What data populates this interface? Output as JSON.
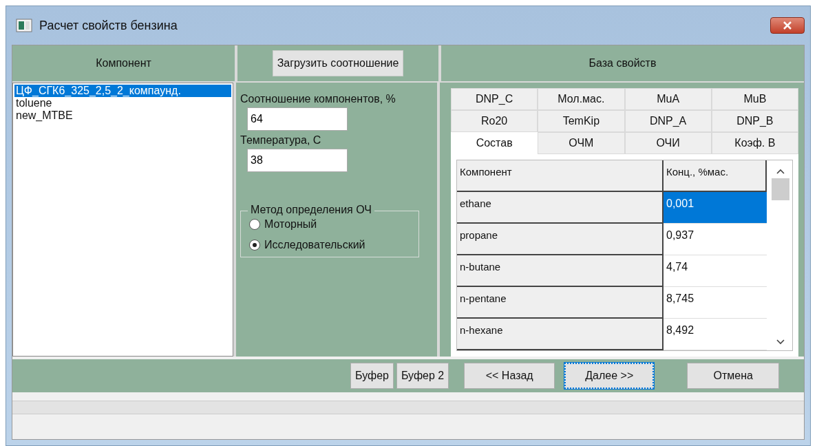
{
  "window": {
    "title": "Расчет свойств бензина"
  },
  "headers": {
    "components": "Компонент",
    "load_button": "Загрузить соотношение",
    "properties": "База свойств"
  },
  "component_list": [
    {
      "label": "ЦФ_СГК6_325_2,5_2_компаунд.",
      "selected": true
    },
    {
      "label": "toluene",
      "selected": false
    },
    {
      "label": "new_MTBE",
      "selected": false
    }
  ],
  "ratio": {
    "label": "Соотношение компонентов, %",
    "value": "64"
  },
  "temperature": {
    "label": "Температура, С",
    "value": "38"
  },
  "octane_method": {
    "title": "Метод определения ОЧ",
    "options": [
      {
        "label": "Моторный",
        "selected": false
      },
      {
        "label": "Исследовательский",
        "selected": true
      }
    ]
  },
  "tab_rows": [
    [
      {
        "label": "DNP_C",
        "selected": false
      },
      {
        "label": "Мол.мас.",
        "selected": false
      },
      {
        "label": "MuA",
        "selected": false
      },
      {
        "label": "MuB",
        "selected": false
      }
    ],
    [
      {
        "label": "Ro20",
        "selected": false
      },
      {
        "label": "TemKip",
        "selected": false
      },
      {
        "label": "DNP_A",
        "selected": false
      },
      {
        "label": "DNP_B",
        "selected": false
      }
    ],
    [
      {
        "label": "Состав",
        "selected": true
      },
      {
        "label": "ОЧМ",
        "selected": false
      },
      {
        "label": "ОЧИ",
        "selected": false
      },
      {
        "label": "Коэф. В",
        "selected": false
      }
    ]
  ],
  "table": {
    "columns": [
      "Компонент",
      "Конц., %мас."
    ],
    "rows": [
      {
        "name": "ethane",
        "value": "0,001",
        "selected": true
      },
      {
        "name": "propane",
        "value": "0,937",
        "selected": false
      },
      {
        "name": "n-butane",
        "value": "4,74",
        "selected": false
      },
      {
        "name": "n-pentane",
        "value": "8,745",
        "selected": false
      },
      {
        "name": "n-hexane",
        "value": "8,492",
        "selected": false
      }
    ]
  },
  "buttons": [
    {
      "label": "Буфер",
      "focused": false
    },
    {
      "label": "Буфер 2",
      "focused": false
    },
    {
      "label": "<< Назад",
      "focused": false
    },
    {
      "label": "Далее >>",
      "focused": true
    },
    {
      "label": "Отмена",
      "focused": false
    }
  ]
}
